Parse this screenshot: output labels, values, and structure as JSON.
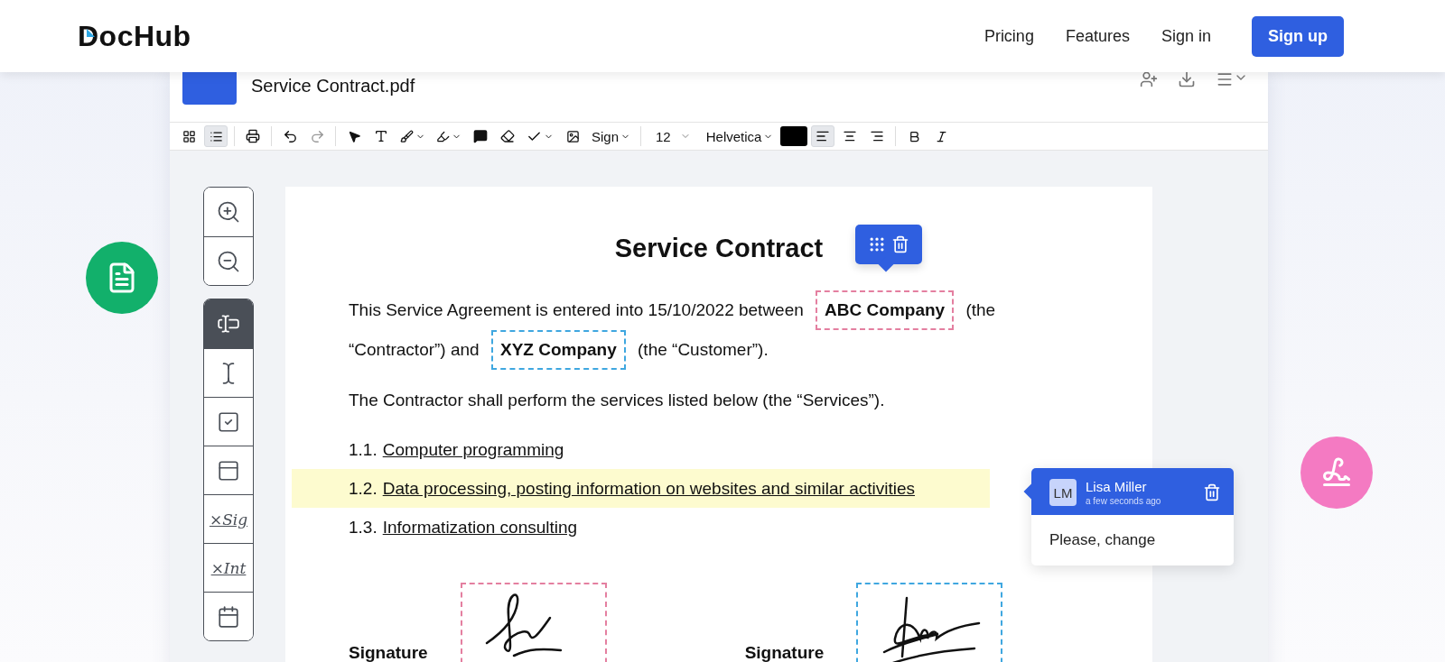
{
  "header": {
    "logo": "DocHub",
    "nav": [
      "Pricing",
      "Features",
      "Sign in"
    ],
    "cta": "Sign up"
  },
  "editor": {
    "file_name": "Service Contract.pdf",
    "toolbar": {
      "view_buttons": [
        {
          "selected": false
        },
        {
          "selected": true
        }
      ],
      "sign_label": "Sign",
      "font_size": "12",
      "font_family": "Helvetica",
      "align_buttons": [
        {
          "selected": true
        },
        {
          "selected": false
        },
        {
          "selected": false
        }
      ]
    },
    "tools": [
      {
        "kind": "text-field",
        "selected": true
      },
      {
        "kind": "text-box",
        "selected": false
      },
      {
        "kind": "checkbox",
        "selected": false
      },
      {
        "kind": "form",
        "selected": false
      },
      {
        "kind": "script",
        "label": "×Sig",
        "selected": false
      },
      {
        "kind": "script",
        "label": "×Int",
        "selected": false
      },
      {
        "kind": "date",
        "selected": false
      }
    ],
    "document": {
      "title": "Service Contract",
      "paragraphs": [
        [
          {
            "kind": "text",
            "text": "This Service Agreement is entered into 15/10/2022 between"
          },
          {
            "kind": "field",
            "text": "ABC Company",
            "color": "#e47fa0",
            "active": true
          },
          {
            "kind": "text",
            "text": "(the"
          },
          {
            "kind": "text",
            "text": "“Contractor”) and"
          },
          {
            "kind": "field",
            "text": "XYZ Company",
            "color": "#3fa7e0",
            "active": false
          },
          {
            "kind": "text",
            "text": "(the “Customer”)."
          }
        ],
        [
          {
            "kind": "text",
            "text": "The Contractor shall perform the services listed below (the “Services”)."
          }
        ]
      ],
      "services": [
        {
          "number": "1.1.",
          "text": "Computer programming",
          "highlighted": false
        },
        {
          "number": "1.2.",
          "text": "Data processing, posting information on websites and similar activities",
          "highlighted": true
        },
        {
          "number": "1.3.",
          "text": "Informatization consulting",
          "highlighted": false
        }
      ],
      "signatures": [
        {
          "label": "Signature",
          "color": "#e47fa0"
        },
        {
          "label": "Signature",
          "color": "#3fa7e0"
        }
      ]
    },
    "comment": {
      "initials": "LM",
      "author": "Lisa Miller",
      "time": "a few seconds ago",
      "text": "Please, change"
    }
  }
}
